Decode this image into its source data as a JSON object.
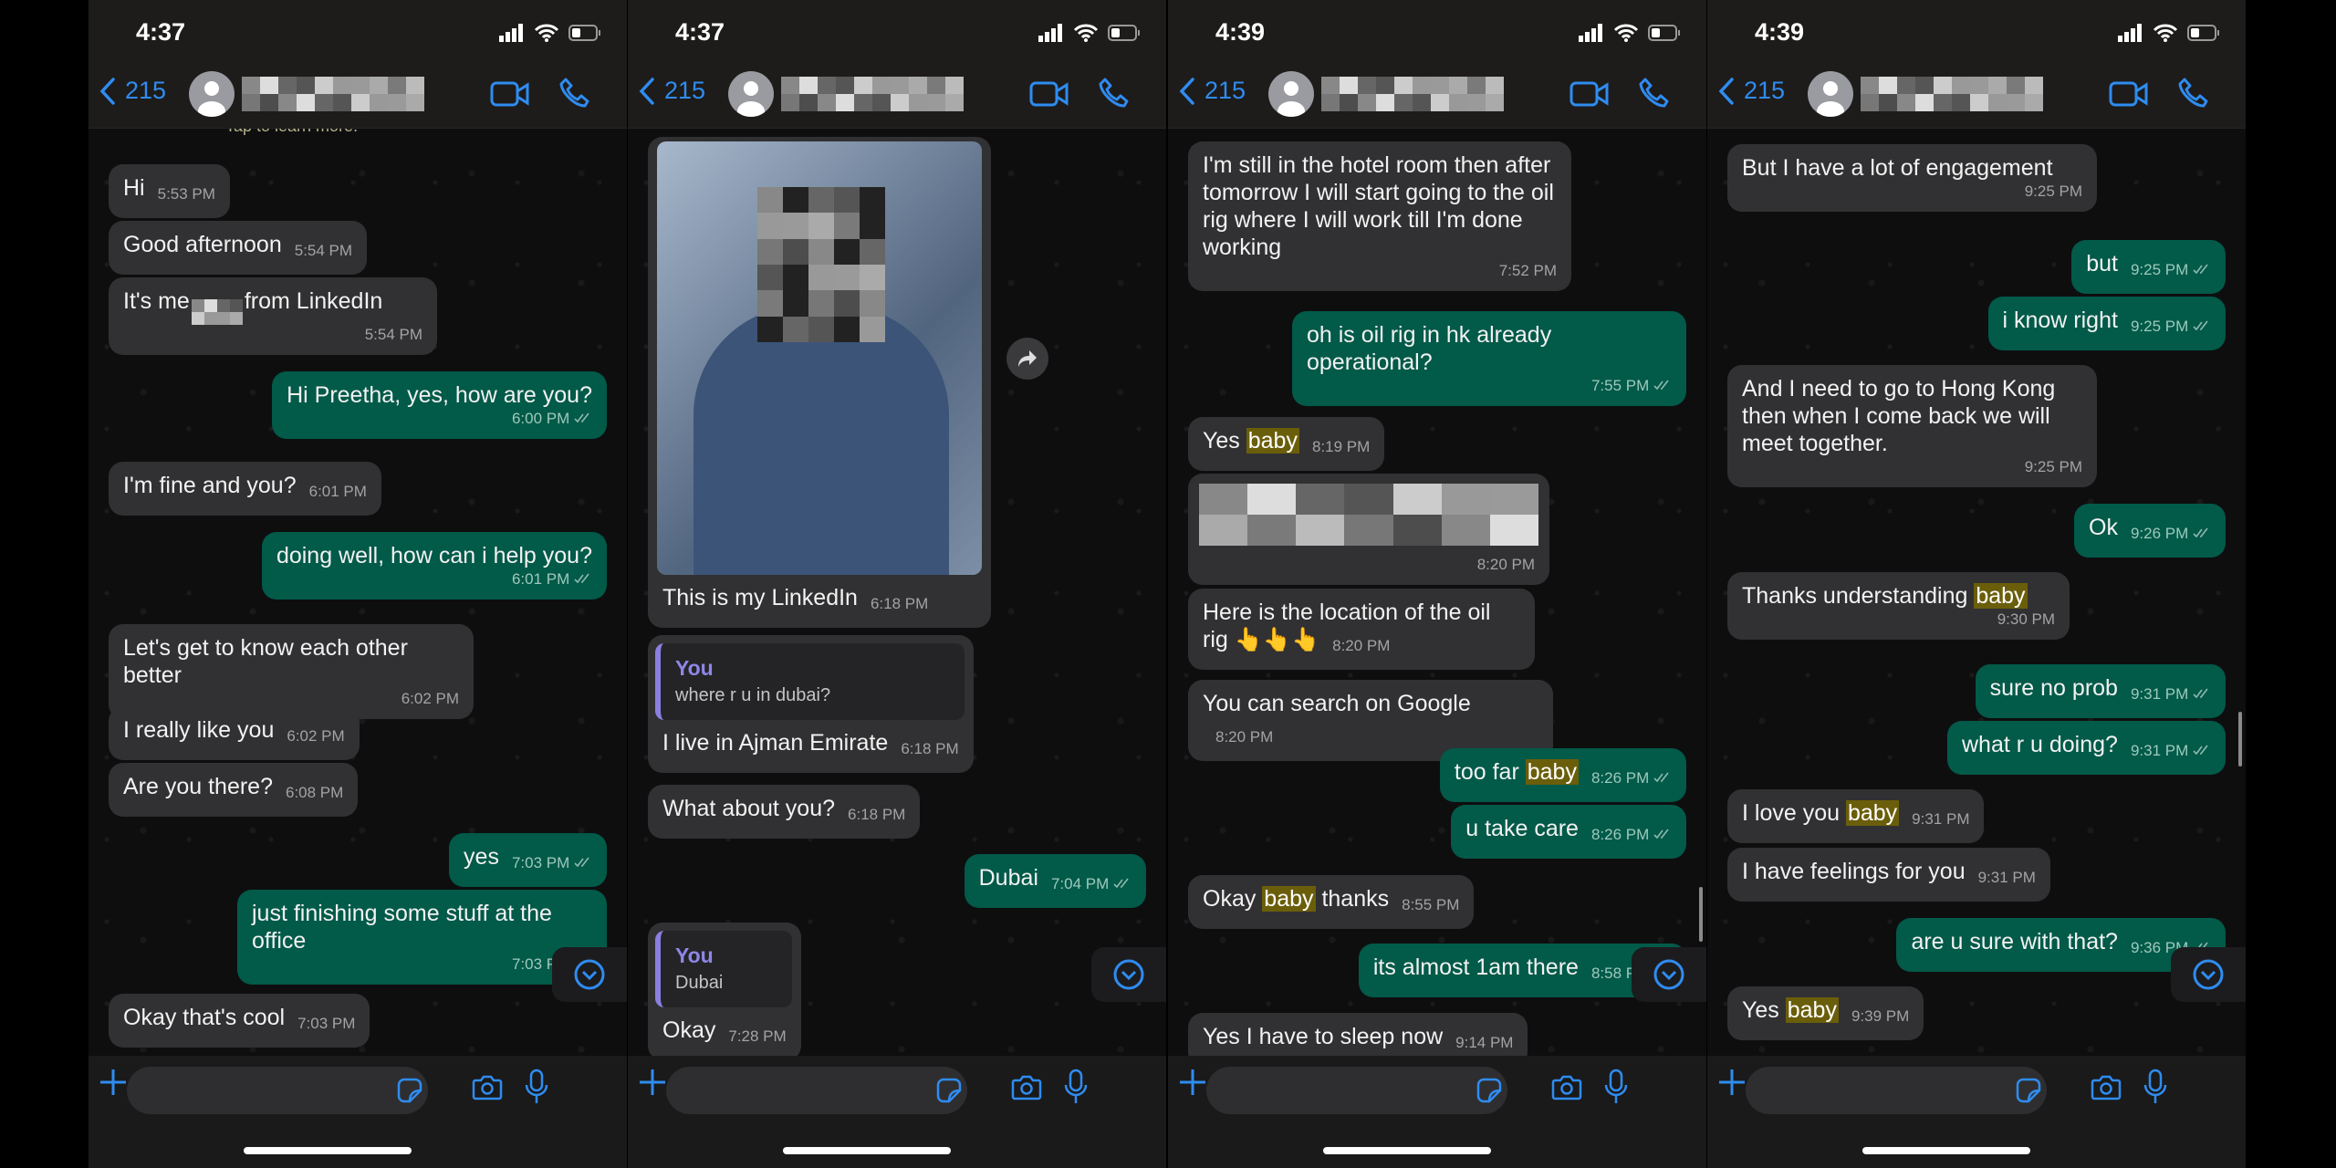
{
  "colors": {
    "accent": "#2f8cf0",
    "incoming_bubble": "#313133",
    "outgoing_bubble": "#025a49",
    "highlight": "#6b5e0a",
    "reply_bar": "#8a80e0"
  },
  "panels": [
    {
      "status_time": "4:37",
      "back_count": "215",
      "tip_text": "Tap to learn more.",
      "messages": [
        {
          "dir": "in",
          "parts": [
            {
              "t": "Hi"
            }
          ],
          "time": "5:53 PM"
        },
        {
          "dir": "in",
          "parts": [
            {
              "t": "Good afternoon"
            }
          ],
          "time": "5:54 PM"
        },
        {
          "dir": "in",
          "parts": [
            {
              "t": "It's me"
            },
            {
              "blur": true
            },
            {
              "t": "from LinkedIn"
            }
          ],
          "time": "5:54 PM",
          "stack": true
        },
        {
          "dir": "out",
          "parts": [
            {
              "t": "Hi Preetha, yes, how are you?"
            }
          ],
          "time": "6:00 PM",
          "ticks": "read",
          "stack": true
        },
        {
          "dir": "in",
          "parts": [
            {
              "t": "I'm fine and you?"
            }
          ],
          "time": "6:01 PM"
        },
        {
          "dir": "out",
          "parts": [
            {
              "t": "doing well, how can i help you?"
            }
          ],
          "time": "6:01 PM",
          "ticks": "read",
          "stack": true
        },
        {
          "dir": "in",
          "parts": [
            {
              "t": "Let's get to know each other better"
            }
          ],
          "time": "6:02 PM",
          "stack": true
        },
        {
          "dir": "in",
          "parts": [
            {
              "t": "I really like you"
            }
          ],
          "time": "6:02 PM"
        },
        {
          "dir": "in",
          "parts": [
            {
              "t": "Are you there?"
            }
          ],
          "time": "6:08 PM"
        },
        {
          "dir": "out",
          "parts": [
            {
              "t": "yes"
            }
          ],
          "time": "7:03 PM",
          "ticks": "read"
        },
        {
          "dir": "out",
          "parts": [
            {
              "t": "just finishing some stuff at the office"
            }
          ],
          "time": "7:03 PM",
          "ticks": "read",
          "stack": true
        },
        {
          "dir": "in",
          "parts": [
            {
              "t": "Okay that's cool"
            }
          ],
          "time": "7:03 PM"
        }
      ]
    },
    {
      "status_time": "4:37",
      "back_count": "215",
      "messages": [
        {
          "dir": "in",
          "image": true,
          "parts": [
            {
              "t": "This is my LinkedIn"
            }
          ],
          "time": "6:18 PM"
        },
        {
          "dir": "in",
          "reply": {
            "who": "You",
            "text": "where r u in dubai?"
          },
          "parts": [
            {
              "t": "I live in Ajman Emirate"
            }
          ],
          "time": "6:18 PM"
        },
        {
          "dir": "in",
          "parts": [
            {
              "t": "What about you?"
            }
          ],
          "time": "6:18 PM"
        },
        {
          "dir": "out",
          "parts": [
            {
              "t": "Dubai"
            }
          ],
          "time": "7:04 PM",
          "ticks": "read"
        },
        {
          "dir": "in",
          "reply": {
            "who": "You",
            "text": "Dubai"
          },
          "parts": [
            {
              "t": "Okay"
            }
          ],
          "time": "7:28 PM"
        }
      ]
    },
    {
      "status_time": "4:39",
      "back_count": "215",
      "messages": [
        {
          "dir": "in",
          "parts": [
            {
              "t": "I'm still in the hotel room then after tomorrow I will start going to the oil rig where I will work till I'm done working"
            }
          ],
          "time": "7:52 PM",
          "stack": true
        },
        {
          "dir": "out",
          "parts": [
            {
              "t": "oh is oil rig in hk already operational?"
            }
          ],
          "time": "7:55 PM",
          "ticks": "read",
          "stack": true
        },
        {
          "dir": "in",
          "parts": [
            {
              "t": "Yes "
            },
            {
              "t": "baby",
              "hl": true
            }
          ],
          "time": "8:19 PM"
        },
        {
          "dir": "in",
          "link_blur": true,
          "parts": [],
          "time": "8:20 PM",
          "stack": true
        },
        {
          "dir": "in",
          "parts": [
            {
              "t": "Here is the location of the oil rig 👆👆👆"
            }
          ],
          "time": "8:20 PM"
        },
        {
          "dir": "in",
          "parts": [
            {
              "t": "You can search on Google"
            }
          ],
          "time": "8:20 PM"
        },
        {
          "dir": "out",
          "parts": [
            {
              "t": "too far "
            },
            {
              "t": "baby",
              "hl": true
            }
          ],
          "time": "8:26 PM",
          "ticks": "read"
        },
        {
          "dir": "out",
          "parts": [
            {
              "t": "u take care"
            }
          ],
          "time": "8:26 PM",
          "ticks": "read"
        },
        {
          "dir": "in",
          "parts": [
            {
              "t": "Okay "
            },
            {
              "t": "baby",
              "hl": true
            },
            {
              "t": " thanks"
            }
          ],
          "time": "8:55 PM"
        },
        {
          "dir": "out",
          "parts": [
            {
              "t": "its almost 1am there"
            }
          ],
          "time": "8:58 PM",
          "ticks": "read"
        },
        {
          "dir": "in",
          "parts": [
            {
              "t": "Yes I have to sleep now"
            }
          ],
          "time": "9:14 PM"
        }
      ]
    },
    {
      "status_time": "4:39",
      "back_count": "215",
      "messages": [
        {
          "dir": "in",
          "parts": [
            {
              "t": "But I have a lot of engagement"
            }
          ],
          "time": "9:25 PM",
          "stack": true
        },
        {
          "dir": "out",
          "parts": [
            {
              "t": "but"
            }
          ],
          "time": "9:25 PM",
          "ticks": "read"
        },
        {
          "dir": "out",
          "parts": [
            {
              "t": "i know right"
            }
          ],
          "time": "9:25 PM",
          "ticks": "read"
        },
        {
          "dir": "in",
          "parts": [
            {
              "t": "And I need to go to Hong Kong then when I come back we will meet together."
            }
          ],
          "time": "9:25 PM",
          "stack": true
        },
        {
          "dir": "out",
          "parts": [
            {
              "t": "Ok"
            }
          ],
          "time": "9:26 PM",
          "ticks": "read"
        },
        {
          "dir": "in",
          "parts": [
            {
              "t": "Thanks understanding "
            },
            {
              "t": "baby",
              "hl": true
            }
          ],
          "time": "9:30 PM",
          "stack": true
        },
        {
          "dir": "out",
          "parts": [
            {
              "t": "sure no prob"
            }
          ],
          "time": "9:31 PM",
          "ticks": "read"
        },
        {
          "dir": "out",
          "parts": [
            {
              "t": "what r u doing?"
            }
          ],
          "time": "9:31 PM",
          "ticks": "read"
        },
        {
          "dir": "in",
          "parts": [
            {
              "t": "I love you "
            },
            {
              "t": "baby",
              "hl": true
            }
          ],
          "time": "9:31 PM"
        },
        {
          "dir": "in",
          "parts": [
            {
              "t": "I have feelings for you"
            }
          ],
          "time": "9:31 PM"
        },
        {
          "dir": "out",
          "parts": [
            {
              "t": "are u sure with that?"
            }
          ],
          "time": "9:36 PM",
          "ticks": "read"
        },
        {
          "dir": "in",
          "parts": [
            {
              "t": "Yes "
            },
            {
              "t": "baby",
              "hl": true
            }
          ],
          "time": "9:39 PM"
        }
      ]
    }
  ]
}
